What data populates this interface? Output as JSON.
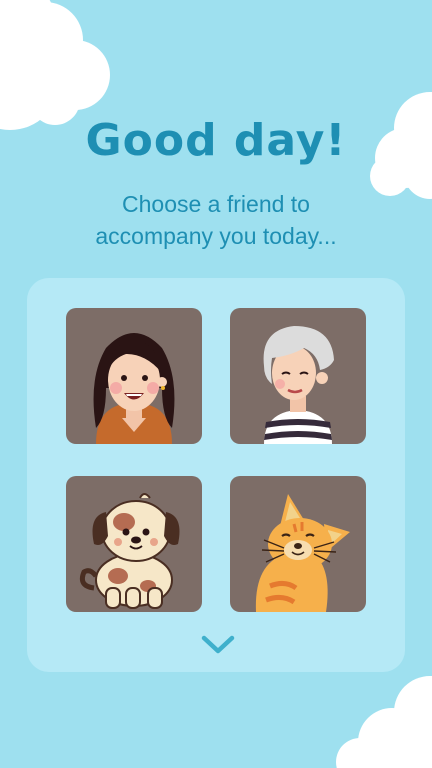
{
  "theme": {
    "background": "#9ee0ef",
    "panel": "#b5e9f6",
    "accent": "#1e8fb3",
    "tile": "#7d6d67",
    "cloud": "#ffffff"
  },
  "header": {
    "title": "Good day!",
    "subtitle_line1": "Choose a friend to",
    "subtitle_line2": "accompany you today..."
  },
  "friends": [
    {
      "id": "girl",
      "icon": "girl-avatar-icon"
    },
    {
      "id": "grandma",
      "icon": "grandma-avatar-icon"
    },
    {
      "id": "dog",
      "icon": "dog-avatar-icon"
    },
    {
      "id": "cat",
      "icon": "cat-avatar-icon"
    }
  ],
  "more_icon": "chevron-down-icon"
}
